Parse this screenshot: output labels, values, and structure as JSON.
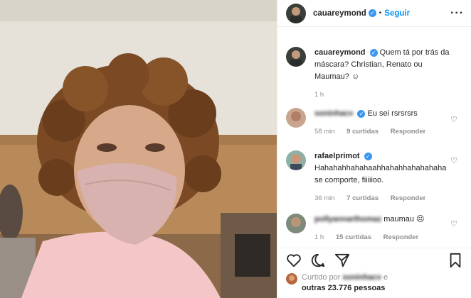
{
  "post": {
    "username": "cauareymond",
    "follow_label": "Seguir",
    "caption": "Quem tá por trás da máscara? Christian, Renato ou Maumau? ☺",
    "caption_time": "1 h"
  },
  "comments": [
    {
      "user": "soninhacv",
      "text": "Eu sei rsrsrsrs",
      "time": "58 min",
      "likes": "9 curtidas",
      "reply": "Responder"
    },
    {
      "user": "rafaelprimot",
      "text": "Hahahahhahahaahhahahhahahahaha se comporte, fiiiiioo.",
      "time": "36 min",
      "likes": "7 curtidas",
      "reply": "Responder"
    },
    {
      "user": "pollyannarthomaz",
      "text": "maumau ☹",
      "time": "1 h",
      "likes": "15 curtidas",
      "reply": "Responder"
    }
  ],
  "likes": {
    "prefix": "Curtido por",
    "user": "soninhacv",
    "suffix": "e",
    "others": "outras 23.776 pessoas"
  },
  "icons": [
    "heart-icon",
    "comment-icon",
    "share-icon",
    "bookmark-icon",
    "more-options-icon",
    "verified-icon"
  ],
  "colors": {
    "accent": "#0095f6",
    "verified": "#3897f0",
    "muted": "#8e8e8e"
  }
}
